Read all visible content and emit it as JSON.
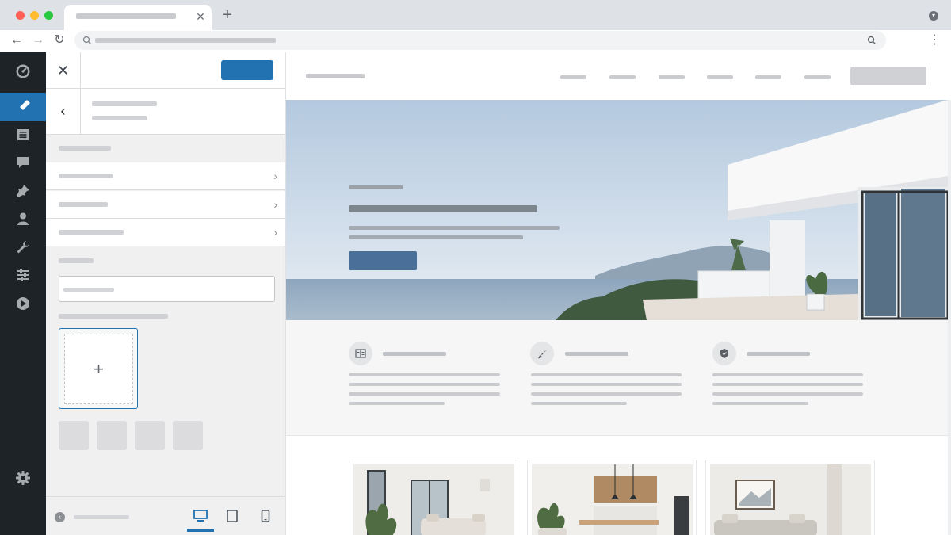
{
  "browser": {
    "tab_title": "",
    "address": "",
    "traffic_lights": [
      "#ff5f57",
      "#febc2e",
      "#28c840"
    ]
  },
  "admin_bar": {
    "items": [
      {
        "icon": "dashboard-icon"
      },
      {
        "icon": "appearance-icon",
        "active": true
      },
      {
        "icon": "pages-icon"
      },
      {
        "icon": "comments-icon"
      },
      {
        "icon": "posts-icon"
      },
      {
        "icon": "users-icon"
      },
      {
        "icon": "tools-icon"
      },
      {
        "icon": "settings-sliders-icon"
      },
      {
        "icon": "media-play-icon"
      },
      {
        "icon": "gear-icon"
      }
    ]
  },
  "customizer": {
    "publish_label": "",
    "section_title": "",
    "section_subtitle": "",
    "group_heading": "",
    "menu_items": [
      "",
      "",
      ""
    ],
    "field_label": "",
    "field_value": "",
    "logo_label": "",
    "footer_label": "",
    "devices": [
      "desktop-icon",
      "tablet-icon",
      "mobile-icon"
    ],
    "accent": "#2271b1"
  },
  "preview": {
    "site_title": "",
    "nav_items": [
      "",
      "",
      "",
      "",
      "",
      ""
    ],
    "nav_cta": "",
    "hero": {
      "eyebrow": "",
      "headline": "",
      "subtext": "",
      "cta": "",
      "cta_color": "#4a6f99"
    },
    "features": [
      {
        "icon": "layout-icon",
        "title": "",
        "text": ""
      },
      {
        "icon": "brush-icon",
        "title": "",
        "text": ""
      },
      {
        "icon": "shield-icon",
        "title": "",
        "text": ""
      }
    ]
  }
}
